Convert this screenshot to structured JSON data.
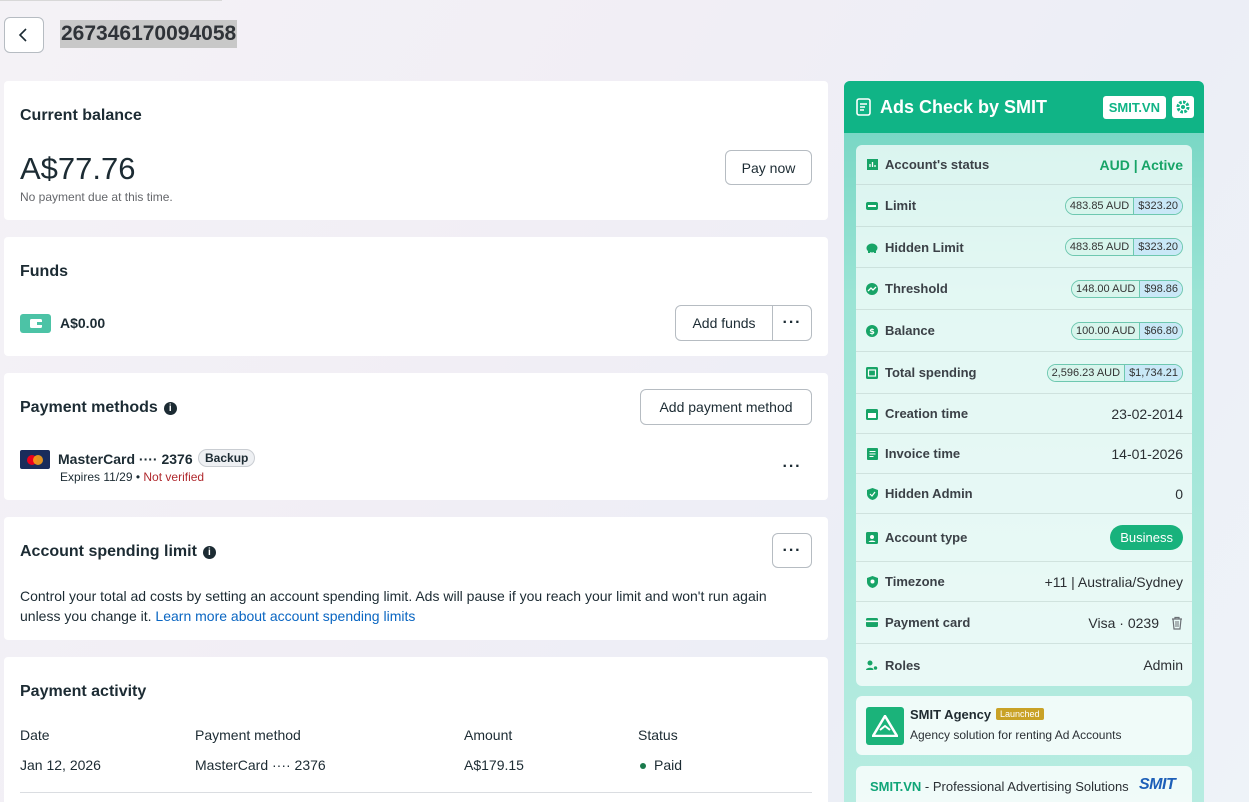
{
  "header": {
    "account_id": "267346170094058"
  },
  "balance": {
    "title": "Current balance",
    "amount": "A$77.76",
    "note": "No payment due at this time.",
    "pay_label": "Pay now"
  },
  "funds": {
    "title": "Funds",
    "amount": "A$0.00",
    "add_label": "Add funds",
    "more_label": "···"
  },
  "payment_methods": {
    "title": "Payment methods",
    "add_label": "Add payment method",
    "card_name": "MasterCard ···· 2376",
    "badge": "Backup",
    "expires": "Expires 11/29",
    "separator": "•",
    "verification": "Not verified",
    "more_label": "···"
  },
  "spending_limit": {
    "title": "Account spending limit",
    "description": "Control your total ad costs by setting an account spending limit. Ads will pause if you reach your limit and won't run again unless you change it.",
    "link": "Learn more about account spending limits",
    "more_label": "···"
  },
  "activity": {
    "title": "Payment activity",
    "columns": [
      "Date",
      "Payment method",
      "Amount",
      "Status"
    ],
    "rows": [
      {
        "date": "Jan 12, 2026",
        "method": "MasterCard ···· 2376",
        "amount": "A$179.15",
        "status": "Paid"
      }
    ]
  },
  "ads_check": {
    "title": "Ads Check by SMIT",
    "badge": "SMIT.VN",
    "rows": {
      "status": {
        "label": "Account's status",
        "value": "AUD | Active"
      },
      "limit": {
        "label": "Limit",
        "aud": "483.85 AUD",
        "usd": "$323.20"
      },
      "hidden_limit": {
        "label": "Hidden Limit",
        "aud": "483.85 AUD",
        "usd": "$323.20"
      },
      "threshold": {
        "label": "Threshold",
        "aud": "148.00 AUD",
        "usd": "$98.86"
      },
      "balance": {
        "label": "Balance",
        "aud": "100.00 AUD",
        "usd": "$66.80"
      },
      "total_spending": {
        "label": "Total spending",
        "aud": "2,596.23 AUD",
        "usd": "$1,734.21"
      },
      "creation_time": {
        "label": "Creation time",
        "value": "23-02-2014"
      },
      "invoice_time": {
        "label": "Invoice time",
        "value": "14-01-2026"
      },
      "hidden_admin": {
        "label": "Hidden Admin",
        "value": "0"
      },
      "account_type": {
        "label": "Account type",
        "value": "Business"
      },
      "timezone": {
        "label": "Timezone",
        "value": "+11 | Australia/Sydney"
      },
      "payment_card": {
        "label": "Payment card",
        "value": "Visa · 0239"
      },
      "roles": {
        "label": "Roles",
        "value": "Admin"
      }
    },
    "agency": {
      "name": "SMIT Agency",
      "badge": "Launched",
      "desc": "Agency solution for renting Ad Accounts"
    },
    "footer": {
      "brand": "SMIT.VN",
      "text": " - Professional Advertising Solutions",
      "logo": "SMIT"
    }
  },
  "colors": {
    "accent_green": "#10b486",
    "link_blue": "#0a66c2",
    "error_red": "#b0292e"
  }
}
